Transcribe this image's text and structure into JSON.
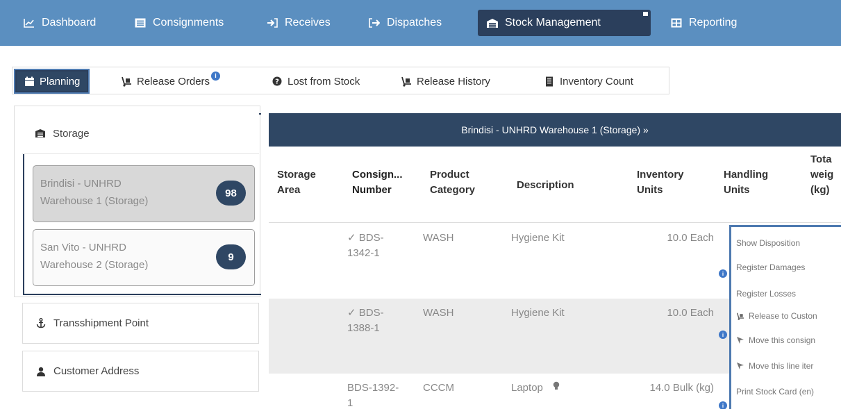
{
  "nav": {
    "items": [
      {
        "label": "Dashboard",
        "icon": "line-chart-icon"
      },
      {
        "label": "Consignments",
        "icon": "list-alt-icon"
      },
      {
        "label": "Receives",
        "icon": "sign-in-icon"
      },
      {
        "label": "Dispatches",
        "icon": "sign-out-icon"
      },
      {
        "label": "Stock Management",
        "icon": "warehouse-icon"
      },
      {
        "label": "Reporting",
        "icon": "table-icon"
      }
    ]
  },
  "subtabs": {
    "items": [
      {
        "label": "Planning",
        "icon": "calendar-icon"
      },
      {
        "label": "Release Orders",
        "icon": "dolly-icon"
      },
      {
        "label": "Lost from Stock",
        "icon": "question-circle-icon"
      },
      {
        "label": "Release History",
        "icon": "dolly-icon"
      },
      {
        "label": "Inventory Count",
        "icon": "document-icon"
      }
    ]
  },
  "left": {
    "storage_label": "Storage",
    "warehouses": [
      {
        "line1": "Brindisi - UNHRD",
        "line2": "Warehouse 1 (Storage)",
        "count": "98"
      },
      {
        "line1": "San Vito - UNHRD",
        "line2": "Warehouse 2 (Storage)",
        "count": "9"
      }
    ],
    "transshipment_label": "Transshipment Point",
    "customer_label": "Customer Address"
  },
  "table": {
    "title": "Brindisi - UNHRD Warehouse 1 (Storage) »",
    "headers": {
      "storage": [
        "Storage",
        "Area"
      ],
      "consign": [
        "Consign...",
        "Number"
      ],
      "category": [
        "Product",
        "Category"
      ],
      "description": "Description",
      "inventory": [
        "Inventory",
        "Units"
      ],
      "handling": [
        "Handling",
        "Units"
      ],
      "total": [
        "Tota",
        "weig",
        "(kg)"
      ]
    },
    "rows": [
      {
        "consign1": "✓ BDS-",
        "consign2": "1342-1",
        "category": "WASH",
        "description": "Hygiene Kit",
        "units": "10.0 Each"
      },
      {
        "consign1": "✓ BDS-",
        "consign2": "1388-1",
        "category": "WASH",
        "description": "Hygiene Kit",
        "units": "10.0 Each"
      },
      {
        "consign1": "BDS-1392-",
        "consign2": "1",
        "category": "CCCM",
        "description": "Laptop",
        "units": "14.0 Bulk (kg)"
      }
    ]
  },
  "menu": {
    "items": [
      "Show Disposition",
      "Register Damages",
      "Register Losses",
      "Release to Custon",
      "Move this consign",
      "Move this line iter",
      "Print Stock Card (en)"
    ]
  }
}
